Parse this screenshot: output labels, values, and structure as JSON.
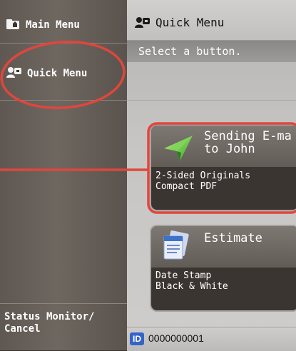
{
  "sidebar": {
    "items": [
      {
        "label": "Main Menu",
        "icon": "home-folder-icon"
      },
      {
        "label": "Quick Menu",
        "icon": "quick-menu-icon"
      }
    ],
    "status_label": "Status Monitor/\nCancel"
  },
  "header": {
    "title": "Quick Menu",
    "icon": "quick-menu-icon"
  },
  "instruction": "Select a button.",
  "cards": [
    {
      "title": "Sending E-ma\nto John",
      "icon": "paper-plane-icon",
      "lines": [
        "2-Sided Originals",
        "Compact PDF"
      ],
      "highlighted": true
    },
    {
      "title": "Estimate",
      "icon": "document-stack-icon",
      "lines": [
        "Date Stamp",
        "Black & White"
      ],
      "highlighted": false
    }
  ],
  "footer": {
    "id_badge": "ID",
    "id_number": "0000000001"
  },
  "colors": {
    "annotation_red": "#e0463d",
    "id_blue": "#3464c8"
  }
}
